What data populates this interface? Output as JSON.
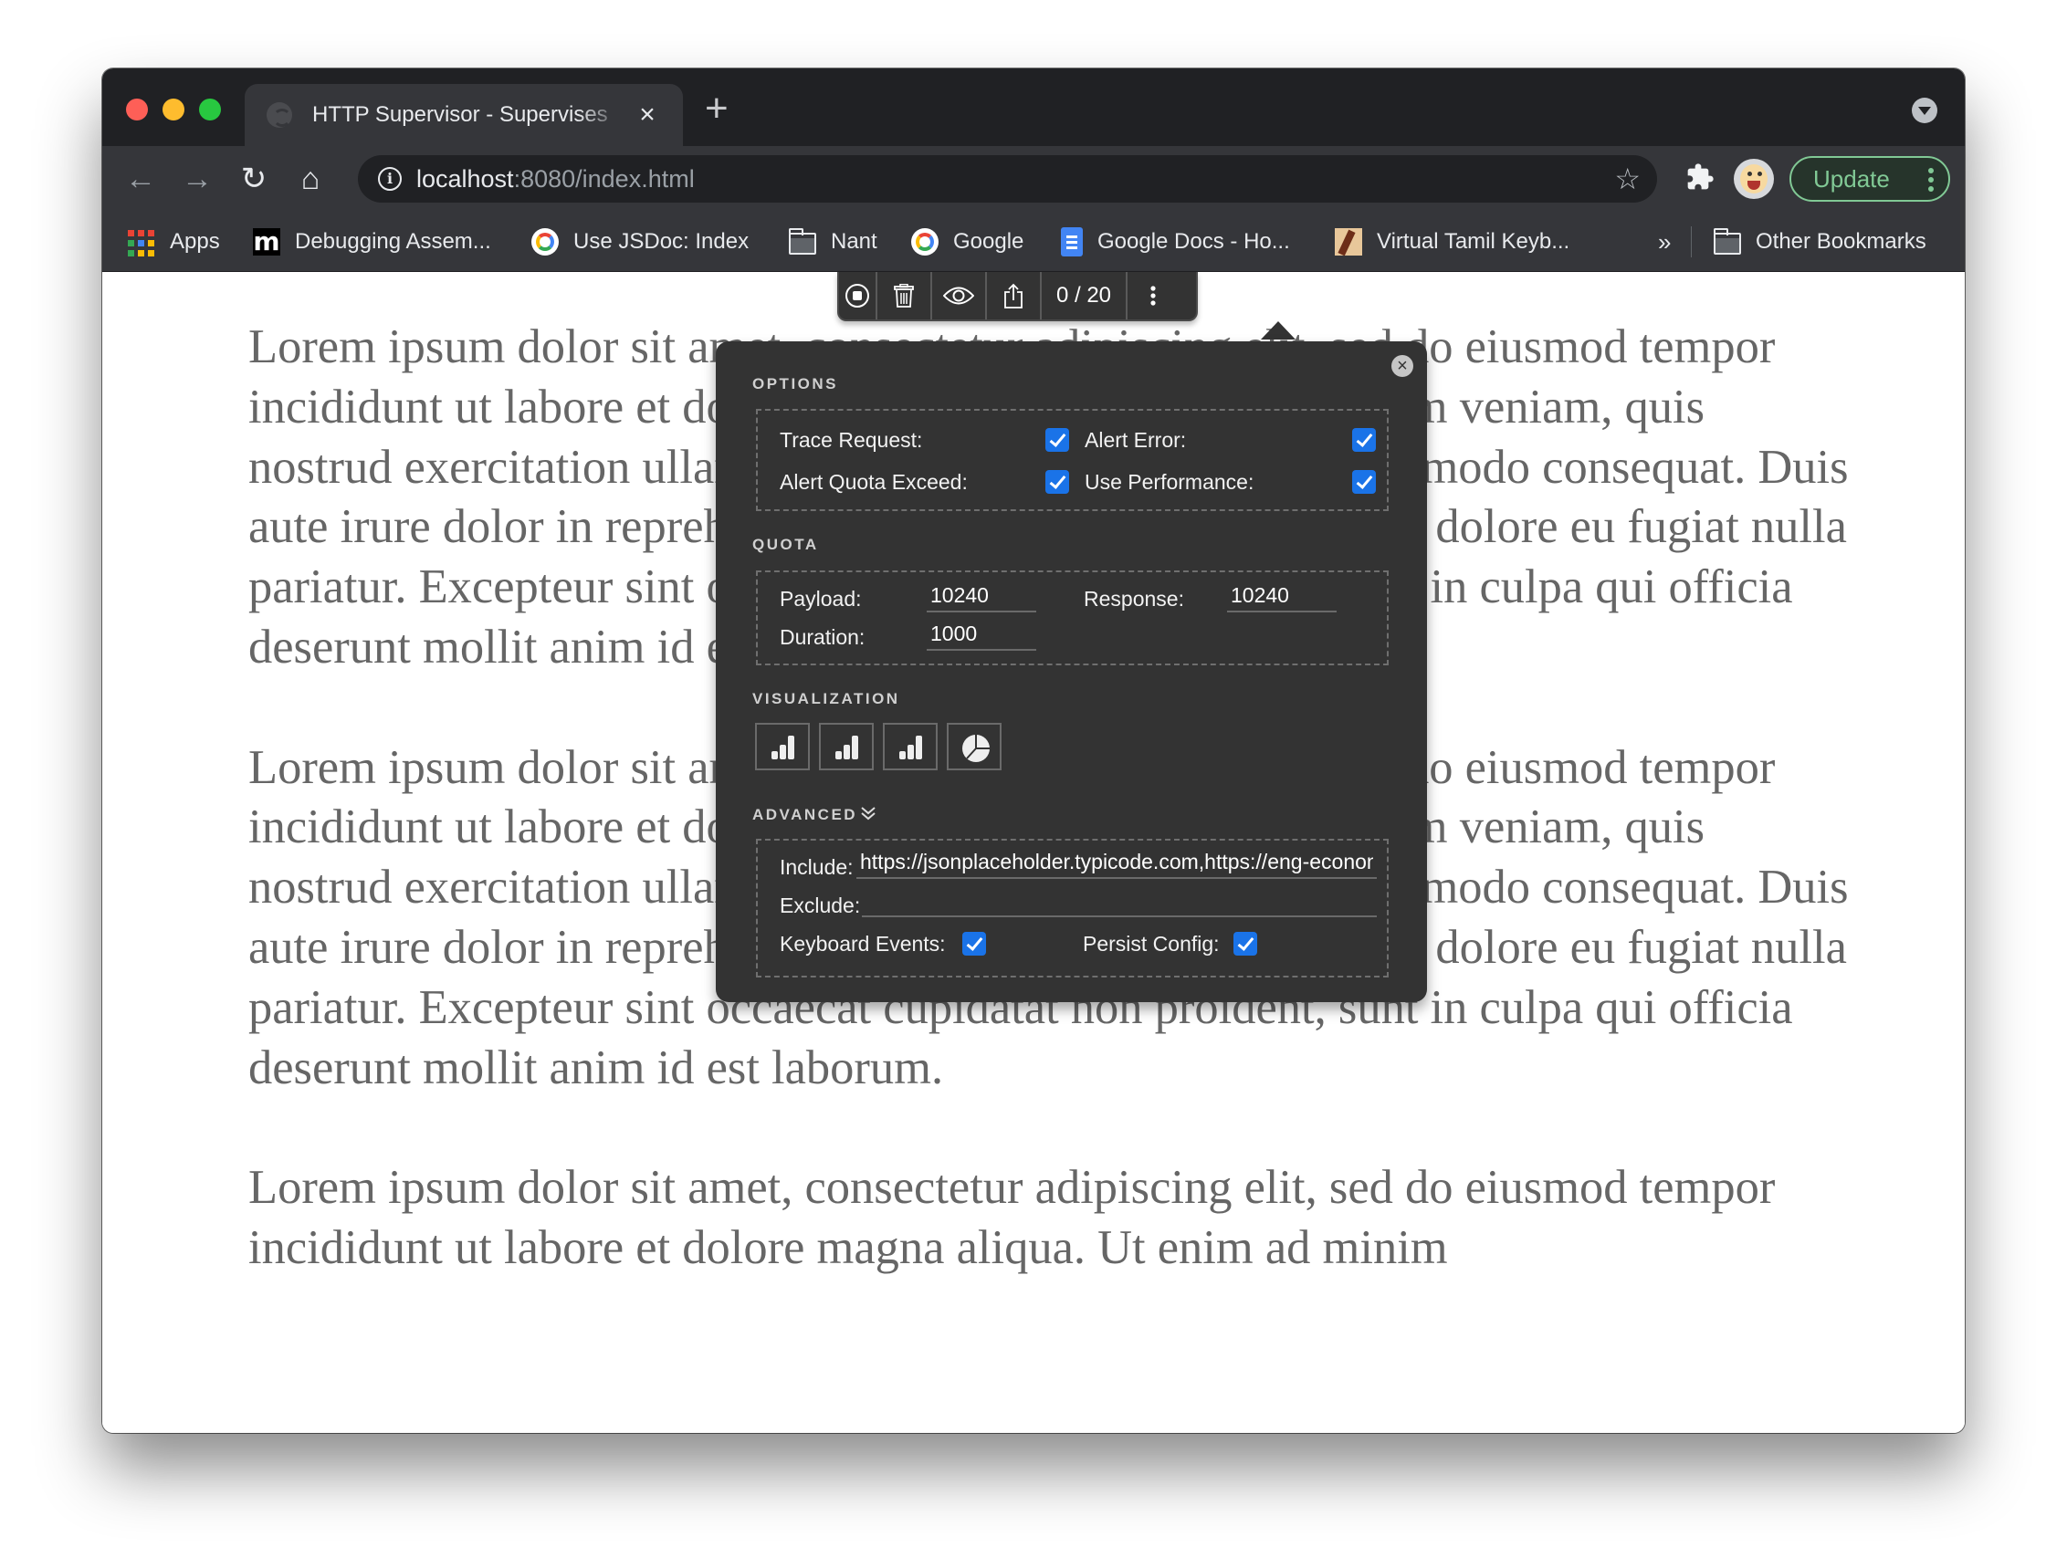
{
  "browser": {
    "tab": {
      "title": "HTTP Supervisor - Supervises",
      "close_glyph": "×",
      "favicon": "globe-icon"
    },
    "new_tab_glyph": "+",
    "nav": {
      "back": "←",
      "forward": "→",
      "reload": "↻",
      "home": "⌂"
    },
    "address": {
      "host": "localhost",
      "rest": ":8080/index.html",
      "info_glyph": "i"
    },
    "bookmark_star": "☆",
    "extensions_glyph": "✱",
    "update_label": "Update",
    "bookmarks": [
      {
        "label": "Apps",
        "icon": "apps-grid-icon"
      },
      {
        "label": "Debugging Assem...",
        "icon": "m-favicon"
      },
      {
        "label": "Use JSDoc: Index",
        "icon": "google-favicon"
      },
      {
        "label": "Nant",
        "icon": "folder-icon"
      },
      {
        "label": "Google",
        "icon": "google-favicon"
      },
      {
        "label": "Google Docs - Ho...",
        "icon": "google-docs-favicon"
      },
      {
        "label": "Virtual Tamil Keyb...",
        "icon": "tamil-keyboard-favicon"
      }
    ],
    "bookmarks_overflow": "»",
    "other_bookmarks": "Other Bookmarks"
  },
  "page": {
    "paragraphs": [
      "Lorem ipsum dolor sit amet, consectetur adipiscing elit, sed do eiusmod tempor incididunt ut labore et dolore magna aliqua. Ut enim ad minim veniam, quis nostrud exercitation ullamco laboris nisi ut aliquip ex ea commodo consequat. Duis aute irure dolor in reprehenderit in voluptate velit esse cillum dolore eu fugiat nulla pariatur. Excepteur sint occaecat cupidatat non proident, sunt in culpa qui officia deserunt mollit anim id est laborum.",
      "Lorem ipsum dolor sit amet, consectetur adipiscing elit, sed do eiusmod tempor incididunt ut labore et dolore magna aliqua. Ut enim ad minim veniam, quis nostrud exercitation ullamco laboris nisi ut aliquip ex ea commodo consequat. Duis aute irure dolor in reprehenderit in voluptate velit esse cillum dolore eu fugiat nulla pariatur. Excepteur sint occaecat cupidatat non proident, sunt in culpa qui officia deserunt mollit anim id est laborum.",
      "Lorem ipsum dolor sit amet, consectetur adipiscing elit, sed do eiusmod tempor incididunt ut labore et dolore magna aliqua. Ut enim ad minim"
    ]
  },
  "supervisor": {
    "toolbar": {
      "buttons": [
        "stop-record",
        "clear",
        "view",
        "export"
      ],
      "counter": "0 / 20"
    },
    "popup": {
      "close_glyph": "×",
      "options": {
        "title": "OPTIONS",
        "items": [
          {
            "label": "Trace Request:",
            "checked": true
          },
          {
            "label": "Alert Error:",
            "checked": true
          },
          {
            "label": "Alert Quota Exceed:",
            "checked": true
          },
          {
            "label": "Use Performance:",
            "checked": true
          }
        ]
      },
      "quota": {
        "title": "QUOTA",
        "payload_label": "Payload:",
        "payload_value": "10240",
        "response_label": "Response:",
        "response_value": "10240",
        "duration_label": "Duration:",
        "duration_value": "1000"
      },
      "visualization": {
        "title": "VISUALIZATION",
        "buttons": [
          "bar-chart",
          "bar-chart",
          "bar-chart",
          "pie-chart"
        ]
      },
      "advanced": {
        "title": "ADVANCED",
        "include_label": "Include:",
        "include_value": "https://jsonplaceholder.typicode.com,https://eng-economics",
        "exclude_label": "Exclude:",
        "exclude_value": "",
        "keyboard_label": "Keyboard Events:",
        "keyboard_checked": true,
        "persist_label": "Persist Config:",
        "persist_checked": true
      }
    }
  },
  "colors": {
    "accent_checkbox": "#1a73e8",
    "update_green": "#81c995",
    "panel_bg": "#333333",
    "body_text": "#666666"
  }
}
